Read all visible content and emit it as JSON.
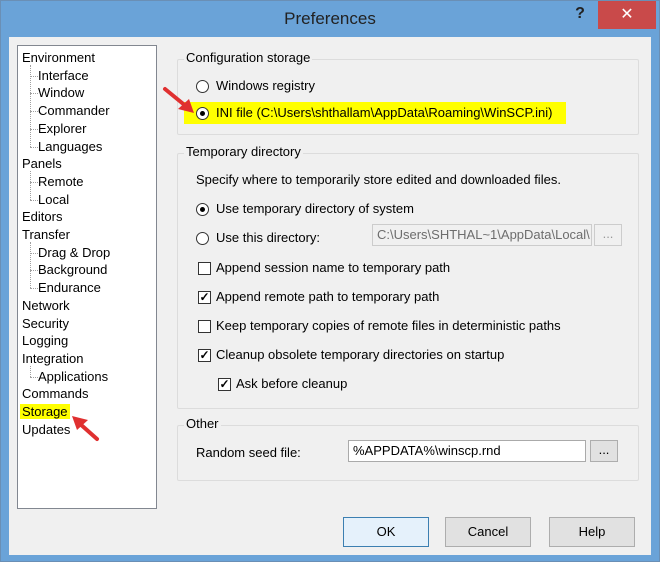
{
  "window": {
    "title": "Preferences",
    "help_glyph": "?",
    "close_glyph": "✕"
  },
  "tree": {
    "items": [
      {
        "label": "Environment",
        "level": 0
      },
      {
        "label": "Interface",
        "level": 1
      },
      {
        "label": "Window",
        "level": 1
      },
      {
        "label": "Commander",
        "level": 1
      },
      {
        "label": "Explorer",
        "level": 1
      },
      {
        "label": "Languages",
        "level": 1
      },
      {
        "label": "Panels",
        "level": 0
      },
      {
        "label": "Remote",
        "level": 1
      },
      {
        "label": "Local",
        "level": 1
      },
      {
        "label": "Editors",
        "level": 0
      },
      {
        "label": "Transfer",
        "level": 0
      },
      {
        "label": "Drag & Drop",
        "level": 1
      },
      {
        "label": "Background",
        "level": 1
      },
      {
        "label": "Endurance",
        "level": 1
      },
      {
        "label": "Network",
        "level": 0
      },
      {
        "label": "Security",
        "level": 0
      },
      {
        "label": "Logging",
        "level": 0
      },
      {
        "label": "Integration",
        "level": 0
      },
      {
        "label": "Applications",
        "level": 1
      },
      {
        "label": "Commands",
        "level": 0
      },
      {
        "label": "Storage",
        "level": 0,
        "selected": true
      },
      {
        "label": "Updates",
        "level": 0
      }
    ]
  },
  "config_storage": {
    "legend": "Configuration storage",
    "option_registry": "Windows registry",
    "option_ini": "INI file (C:\\Users\\shthallam\\AppData\\Roaming\\WinSCP.ini)",
    "selected": "ini"
  },
  "temp_dir": {
    "legend": "Temporary directory",
    "description": "Specify where to temporarily store edited and downloaded files.",
    "option_system": "Use temporary directory of system",
    "option_this": "Use this directory:",
    "directory_value": "C:\\Users\\SHTHAL~1\\AppData\\Local\\",
    "browse": "...",
    "append_session": {
      "label": "Append session name to temporary path",
      "checked": false
    },
    "append_remote": {
      "label": "Append remote path to temporary path",
      "checked": true
    },
    "keep_copies": {
      "label": "Keep temporary copies of remote files in deterministic paths",
      "checked": false
    },
    "cleanup": {
      "label": "Cleanup obsolete temporary directories on startup",
      "checked": true
    },
    "ask_cleanup": {
      "label": "Ask before cleanup",
      "checked": true
    }
  },
  "other": {
    "legend": "Other",
    "seed_label": "Random seed file:",
    "seed_value": "%APPDATA%\\winscp.rnd",
    "browse": "..."
  },
  "buttons": {
    "ok": "OK",
    "cancel": "Cancel",
    "help": "Help"
  },
  "colors": {
    "highlight": "#ffff00",
    "annotation_arrow": "#e03030",
    "title_bar": "#6aa3d8",
    "close_button": "#c94a4a"
  }
}
